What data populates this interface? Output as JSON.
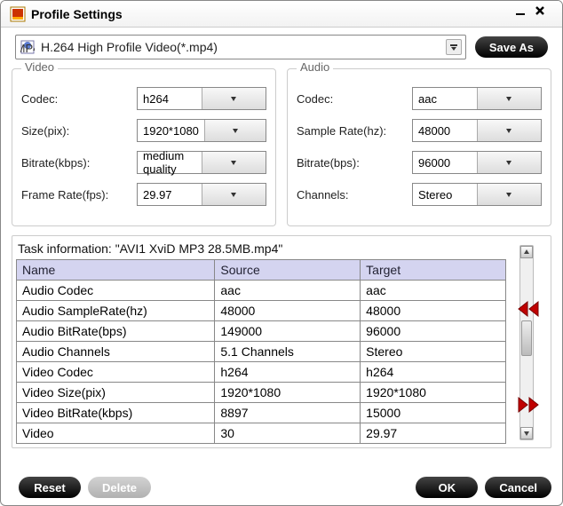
{
  "window": {
    "title": "Profile Settings"
  },
  "topbar": {
    "profile_label": "H.264 High Profile Video(*.mp4)",
    "save_as": "Save As"
  },
  "video_group": {
    "title": "Video",
    "codec_label": "Codec:",
    "codec_value": "h264",
    "size_label": "Size(pix):",
    "size_value": "1920*1080",
    "bitrate_label": "Bitrate(kbps):",
    "bitrate_value": "medium quality",
    "framerate_label": "Frame Rate(fps):",
    "framerate_value": "29.97"
  },
  "audio_group": {
    "title": "Audio",
    "codec_label": "Codec:",
    "codec_value": "aac",
    "samplerate_label": "Sample Rate(hz):",
    "samplerate_value": "48000",
    "bitrate_label": "Bitrate(bps):",
    "bitrate_value": "96000",
    "channels_label": "Channels:",
    "channels_value": "Stereo"
  },
  "task": {
    "info": "Task information: \"AVI1 XviD MP3 28.5MB.mp4\"",
    "headers": {
      "name": "Name",
      "source": "Source",
      "target": "Target"
    },
    "rows": [
      {
        "name": "Audio Codec",
        "source": "aac",
        "target": "aac"
      },
      {
        "name": "Audio SampleRate(hz)",
        "source": "48000",
        "target": "48000"
      },
      {
        "name": "Audio BitRate(bps)",
        "source": "149000",
        "target": "96000"
      },
      {
        "name": "Audio Channels",
        "source": "5.1 Channels",
        "target": "Stereo"
      },
      {
        "name": "Video Codec",
        "source": "h264",
        "target": "h264"
      },
      {
        "name": "Video Size(pix)",
        "source": "1920*1080",
        "target": "1920*1080"
      },
      {
        "name": "Video BitRate(kbps)",
        "source": "8897",
        "target": "15000"
      },
      {
        "name": "Video",
        "source": "30",
        "target": "29.97"
      }
    ]
  },
  "footer": {
    "reset": "Reset",
    "delete": "Delete",
    "ok": "OK",
    "cancel": "Cancel"
  }
}
